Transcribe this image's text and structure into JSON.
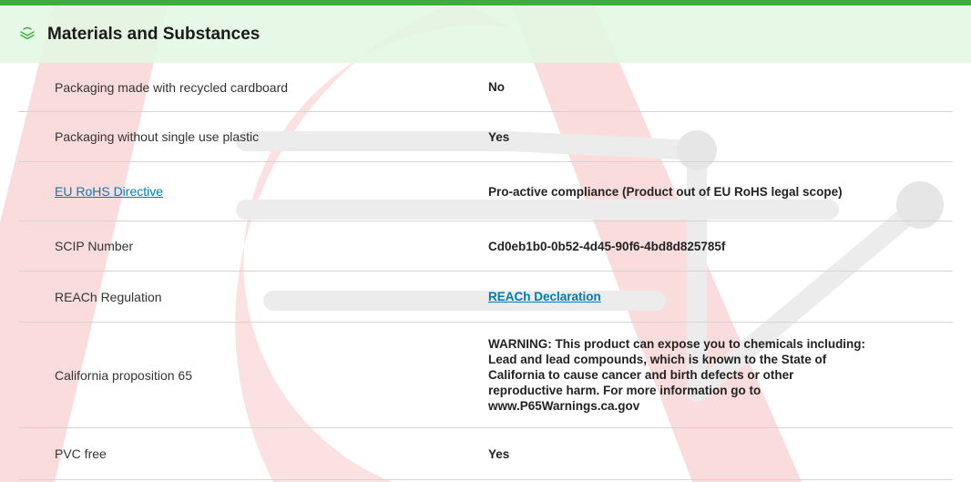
{
  "section": {
    "title": "Materials and Substances",
    "icon": "layers-leaf-icon"
  },
  "colors": {
    "accent_bar": "#3dab3d",
    "header_bg": "#e2f7e2",
    "link": "#007bb8",
    "divider": "#d4d4d4"
  },
  "rows": [
    {
      "label": "Packaging made with recycled cardboard",
      "value": "No"
    },
    {
      "label": "Packaging without single use plastic",
      "value": "Yes"
    },
    {
      "label": "EU RoHS Directive",
      "value": "Pro-active compliance (Product out of EU RoHS legal scope)"
    },
    {
      "label": "SCIP Number",
      "value": "Cd0eb1b0-0b52-4d45-90f6-4bd8d825785f"
    },
    {
      "label": "REACh Regulation",
      "value": "REACh Declaration"
    },
    {
      "label": "California proposition 65",
      "value": "WARNING: This product can expose you to chemicals including: Lead and lead compounds, which is known to the State of California to cause cancer and birth defects or other reproductive harm. For more information go to www.P65Warnings.ca.gov"
    },
    {
      "label": "PVC free",
      "value": "Yes"
    }
  ]
}
